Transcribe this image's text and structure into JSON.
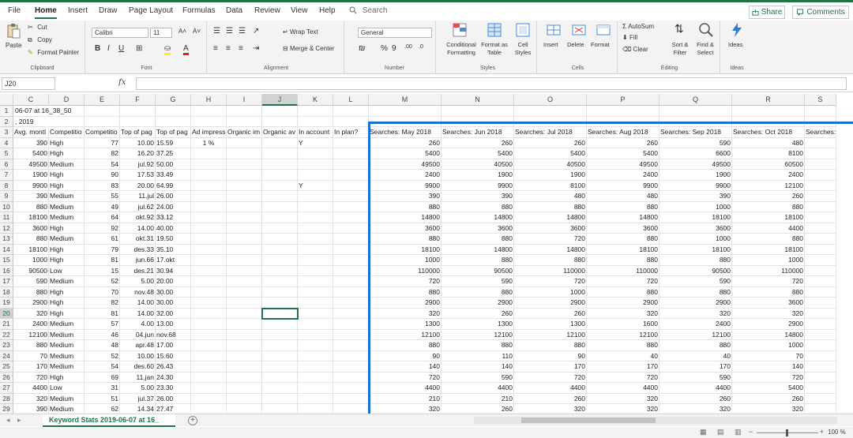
{
  "menu": {
    "items": [
      "File",
      "Home",
      "Insert",
      "Draw",
      "Page Layout",
      "Formulas",
      "Data",
      "Review",
      "View",
      "Help"
    ],
    "search": "Search",
    "share": "Share",
    "comments": "Comments"
  },
  "ribbon": {
    "clipboard": {
      "paste": "Paste",
      "cut": "Cut",
      "copy": "Copy",
      "format_painter": "Format Painter",
      "label": "Clipboard"
    },
    "font": {
      "name": "Calibri",
      "size": "11",
      "label": "Font",
      "grow": "A˄",
      "shrink": "A˅"
    },
    "alignment": {
      "wrap": "Wrap Text",
      "merge": "Merge & Center",
      "label": "Alignment"
    },
    "number": {
      "format": "General",
      "percent": "%",
      "comma": "9",
      "label": "Number"
    },
    "styles": {
      "conditional": "Conditional Formatting",
      "format_table": "Format as Table",
      "cell_styles": "Cell Styles",
      "label": "Styles"
    },
    "cells": {
      "insert": "Insert",
      "delete": "Delete",
      "format": "Format",
      "label": "Cells"
    },
    "editing": {
      "autosum": "AutoSum",
      "fill": "Fill",
      "clear": "Clear",
      "sort": "Sort & Filter",
      "find": "Find & Select",
      "label": "Editing"
    },
    "ideas": {
      "label": "Ideas",
      "button": "Ideas"
    }
  },
  "formula_bar": {
    "name_box": "J20",
    "fx": "fx",
    "value": ""
  },
  "grid": {
    "columns": [
      "C",
      "D",
      "E",
      "F",
      "G",
      "H",
      "I",
      "J",
      "K",
      "L",
      "M",
      "N",
      "O",
      "P",
      "Q",
      "R",
      "S"
    ],
    "selected_column": "J",
    "selected_row": "20",
    "rows": [
      {
        "n": "1",
        "a": "06-07 at 16_38_50"
      },
      {
        "n": "2",
        "a": ", 2019"
      },
      {
        "n": "3",
        "C": "Avg. montl",
        "D": "Competitio",
        "E": "Competitio",
        "F": "Top of pag",
        "G": "Top of pag",
        "H": "Ad impress",
        "I": "Organic im",
        "J": "Organic av",
        "K": "In account",
        "L": "In plan?",
        "M": "Searches: May 2018",
        "N": "Searches: Jun 2018",
        "O": "Searches: Jul 2018",
        "P": "Searches: Aug 2018",
        "Q": "Searches: Sep 2018",
        "R": "Searches: Oct 2018",
        "S": "Searches: I"
      },
      {
        "n": "4",
        "C": "390",
        "D": "High",
        "E": "77",
        "F": "10.00",
        "G": "15.59",
        "H": "1 %",
        "K": "Y",
        "M": "260",
        "N": "260",
        "O": "260",
        "P": "260",
        "Q": "590",
        "R": "480"
      },
      {
        "n": "5",
        "C": "5400",
        "D": "High",
        "E": "82",
        "F": "16.20",
        "G": "37.25",
        "M": "5400",
        "N": "5400",
        "O": "5400",
        "P": "5400",
        "Q": "6600",
        "R": "8100"
      },
      {
        "n": "6",
        "C": "49500",
        "D": "Medium",
        "E": "54",
        "F": "jul.92",
        "G": "50.00",
        "M": "49500",
        "N": "40500",
        "O": "40500",
        "P": "49500",
        "Q": "49500",
        "R": "60500"
      },
      {
        "n": "7",
        "C": "1900",
        "D": "High",
        "E": "90",
        "F": "17.53",
        "G": "33.49",
        "M": "2400",
        "N": "1900",
        "O": "1900",
        "P": "2400",
        "Q": "1900",
        "R": "2400"
      },
      {
        "n": "8",
        "C": "9900",
        "D": "High",
        "E": "83",
        "F": "20.00",
        "G": "64.99",
        "K": "Y",
        "M": "9900",
        "N": "9900",
        "O": "8100",
        "P": "9900",
        "Q": "9900",
        "R": "12100"
      },
      {
        "n": "9",
        "C": "390",
        "D": "Medium",
        "E": "55",
        "F": "11.jul",
        "G": "26.00",
        "M": "390",
        "N": "390",
        "O": "480",
        "P": "480",
        "Q": "390",
        "R": "260"
      },
      {
        "n": "10",
        "C": "880",
        "D": "Medium",
        "E": "49",
        "F": "jul.62",
        "G": "24.00",
        "M": "880",
        "N": "880",
        "O": "880",
        "P": "880",
        "Q": "1000",
        "R": "880"
      },
      {
        "n": "11",
        "C": "18100",
        "D": "Medium",
        "E": "64",
        "F": "okt.92",
        "G": "33.12",
        "M": "14800",
        "N": "14800",
        "O": "14800",
        "P": "14800",
        "Q": "18100",
        "R": "18100"
      },
      {
        "n": "12",
        "C": "3600",
        "D": "High",
        "E": "92",
        "F": "14.00",
        "G": "40.00",
        "M": "3600",
        "N": "3600",
        "O": "3600",
        "P": "3600",
        "Q": "3600",
        "R": "4400"
      },
      {
        "n": "13",
        "C": "880",
        "D": "Medium",
        "E": "61",
        "F": "okt.31",
        "G": "19.50",
        "M": "880",
        "N": "880",
        "O": "720",
        "P": "880",
        "Q": "1000",
        "R": "880"
      },
      {
        "n": "14",
        "C": "18100",
        "D": "High",
        "E": "79",
        "F": "des.33",
        "G": "35.10",
        "M": "18100",
        "N": "14800",
        "O": "14800",
        "P": "18100",
        "Q": "18100",
        "R": "18100"
      },
      {
        "n": "15",
        "C": "1000",
        "D": "High",
        "E": "81",
        "F": "jun.66",
        "G": "17.okt",
        "M": "1000",
        "N": "880",
        "O": "880",
        "P": "880",
        "Q": "880",
        "R": "1000"
      },
      {
        "n": "16",
        "C": "90500",
        "D": "Low",
        "E": "15",
        "F": "des.21",
        "G": "30.94",
        "M": "110000",
        "N": "90500",
        "O": "110000",
        "P": "110000",
        "Q": "90500",
        "R": "110000"
      },
      {
        "n": "17",
        "C": "590",
        "D": "Medium",
        "E": "52",
        "F": "5.00",
        "G": "20.00",
        "M": "720",
        "N": "590",
        "O": "720",
        "P": "720",
        "Q": "590",
        "R": "720"
      },
      {
        "n": "18",
        "C": "880",
        "D": "High",
        "E": "70",
        "F": "nov.48",
        "G": "30.00",
        "M": "880",
        "N": "880",
        "O": "1000",
        "P": "880",
        "Q": "880",
        "R": "880"
      },
      {
        "n": "19",
        "C": "2900",
        "D": "High",
        "E": "82",
        "F": "14.00",
        "G": "30.00",
        "M": "2900",
        "N": "2900",
        "O": "2900",
        "P": "2900",
        "Q": "2900",
        "R": "3600"
      },
      {
        "n": "20",
        "C": "320",
        "D": "High",
        "E": "81",
        "F": "14.00",
        "G": "32.00",
        "M": "320",
        "N": "260",
        "O": "260",
        "P": "320",
        "Q": "320",
        "R": "320"
      },
      {
        "n": "21",
        "C": "2400",
        "D": "Medium",
        "E": "57",
        "F": "4.00",
        "G": "13.00",
        "M": "1300",
        "N": "1300",
        "O": "1300",
        "P": "1600",
        "Q": "2400",
        "R": "2900"
      },
      {
        "n": "22",
        "C": "12100",
        "D": "Medium",
        "E": "46",
        "F": "04.jun",
        "G": "nov.68",
        "M": "12100",
        "N": "12100",
        "O": "12100",
        "P": "12100",
        "Q": "12100",
        "R": "14800"
      },
      {
        "n": "23",
        "C": "880",
        "D": "Medium",
        "E": "48",
        "F": "apr.48",
        "G": "17.00",
        "M": "880",
        "N": "880",
        "O": "880",
        "P": "880",
        "Q": "880",
        "R": "1000"
      },
      {
        "n": "24",
        "C": "70",
        "D": "Medium",
        "E": "52",
        "F": "10.00",
        "G": "15.60",
        "M": "90",
        "N": "110",
        "O": "90",
        "P": "40",
        "Q": "40",
        "R": "70"
      },
      {
        "n": "25",
        "C": "170",
        "D": "Medium",
        "E": "54",
        "F": "des.60",
        "G": "26.43",
        "M": "140",
        "N": "140",
        "O": "170",
        "P": "170",
        "Q": "170",
        "R": "140"
      },
      {
        "n": "26",
        "C": "720",
        "D": "High",
        "E": "69",
        "F": "11.jan",
        "G": "24.30",
        "M": "720",
        "N": "590",
        "O": "720",
        "P": "720",
        "Q": "590",
        "R": "720"
      },
      {
        "n": "27",
        "C": "4400",
        "D": "Low",
        "E": "31",
        "F": "5.00",
        "G": "23.30",
        "M": "4400",
        "N": "4400",
        "O": "4400",
        "P": "4400",
        "Q": "4400",
        "R": "5400"
      },
      {
        "n": "28",
        "C": "320",
        "D": "Medium",
        "E": "51",
        "F": "jul.37",
        "G": "26.00",
        "M": "210",
        "N": "210",
        "O": "260",
        "P": "320",
        "Q": "260",
        "R": "260"
      },
      {
        "n": "29",
        "C": "390",
        "D": "Medium",
        "E": "62",
        "F": "14.34",
        "G": "27.47",
        "M": "320",
        "N": "260",
        "O": "320",
        "P": "320",
        "Q": "320",
        "R": "320"
      }
    ]
  },
  "sheet": {
    "tab": "Keyword Stats 2019-06-07 at 16_",
    "add": "+"
  },
  "status": {
    "zoom": "100 %"
  },
  "colors": {
    "accent": "#217346",
    "highlight": "#1a6fd6"
  }
}
